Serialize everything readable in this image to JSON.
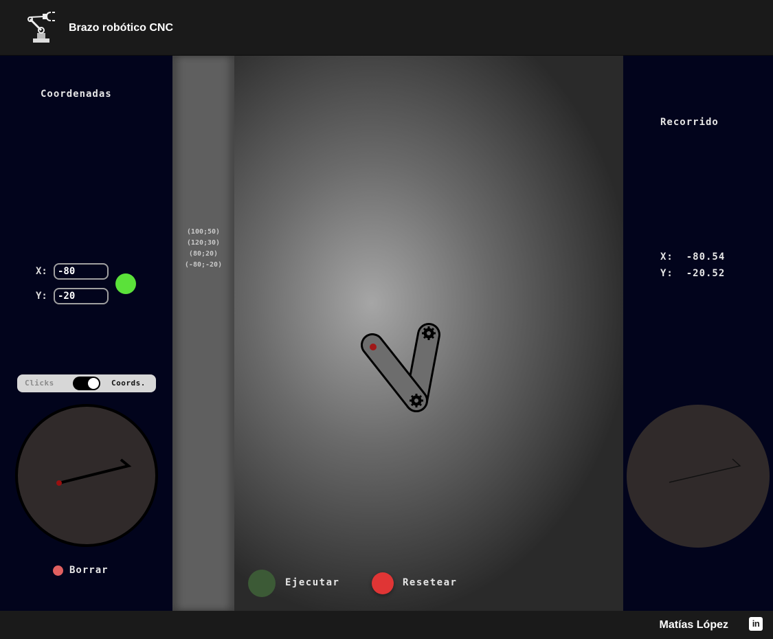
{
  "header": {
    "title": "Brazo robótico CNC",
    "logo_icon": "robot-arm-icon"
  },
  "left_panel": {
    "heading": "Coordenadas",
    "x_label": "X:",
    "x_value": "-80",
    "y_label": "Y:",
    "y_value": "-20",
    "send_color": "#5be13a",
    "mode_toggle": {
      "left_label": "Clicks",
      "right_label": "Coords.",
      "selected": "Coords."
    },
    "clear_label": "Borrar",
    "clear_color": "#e06060"
  },
  "queue": {
    "items": [
      "(100;50)",
      "(120;30)",
      "(80;20)",
      "(-80;-20)"
    ]
  },
  "controls": {
    "run_label": "Ejecutar",
    "run_color": "#3c5a36",
    "reset_label": "Resetear",
    "reset_color": "#e03535"
  },
  "right_panel": {
    "heading": "Recorrido",
    "x_readout": "X:  -80.54",
    "y_readout": "Y:  -20.52"
  },
  "footer": {
    "author": "Matías López",
    "social_icon": "linkedin-icon",
    "social_text": "in"
  }
}
